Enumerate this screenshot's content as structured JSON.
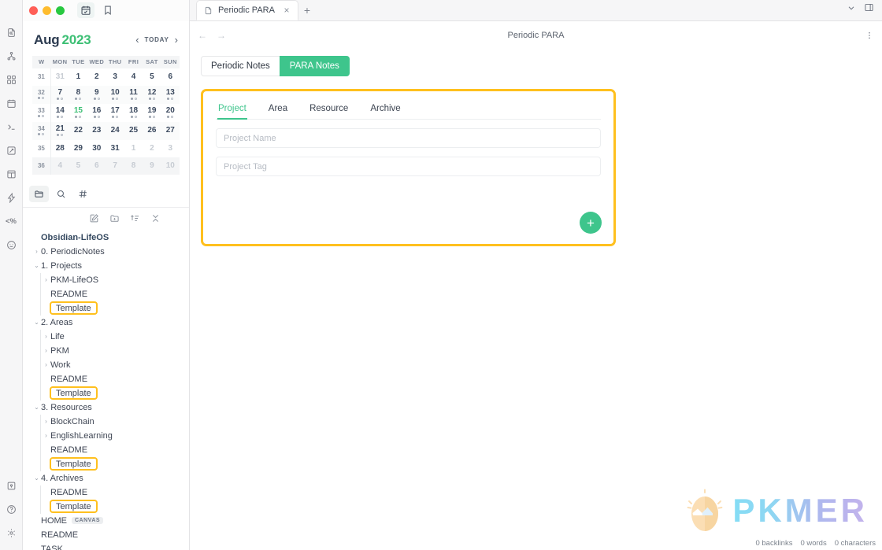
{
  "window": {
    "traffic_lights": [
      "close",
      "minimize",
      "maximize"
    ],
    "titlebar_icons": [
      "calendar-check-icon",
      "bookmark-icon",
      "right-sidebar-toggle-icon"
    ]
  },
  "rail": {
    "items": [
      {
        "name": "file-search-icon",
        "label": ""
      },
      {
        "name": "graph-view-icon",
        "label": ""
      },
      {
        "name": "dashboard-grid-icon",
        "label": ""
      },
      {
        "name": "calendar-icon",
        "label": ""
      },
      {
        "name": "terminal-icon",
        "label": ""
      },
      {
        "name": "excalidraw-icon",
        "label": ""
      },
      {
        "name": "layout-panels-icon",
        "label": ""
      },
      {
        "name": "lightning-icon",
        "label": ""
      },
      {
        "name": "templater-icon",
        "label": "<%"
      },
      {
        "name": "emoji-icon",
        "label": ""
      }
    ],
    "bottom_items": [
      {
        "name": "vault-switcher-icon"
      },
      {
        "name": "help-icon"
      },
      {
        "name": "settings-gear-icon"
      }
    ]
  },
  "calendar": {
    "month": "Aug",
    "year": "2023",
    "today_label": "TODAY",
    "prev_label": "‹",
    "next_label": "›",
    "columns": [
      "W",
      "MON",
      "TUE",
      "WED",
      "THU",
      "FRI",
      "SAT",
      "SUN"
    ],
    "weeks": [
      {
        "week": "31",
        "week_dots": false,
        "days": [
          {
            "n": "31",
            "mute": true,
            "dots": false
          },
          {
            "n": "1",
            "mute": false,
            "dots": false
          },
          {
            "n": "2",
            "mute": false,
            "dots": false
          },
          {
            "n": "3",
            "mute": false,
            "dots": false
          },
          {
            "n": "4",
            "mute": false,
            "dots": false
          },
          {
            "n": "5",
            "mute": false,
            "dots": false
          },
          {
            "n": "6",
            "mute": false,
            "dots": false
          }
        ]
      },
      {
        "week": "32",
        "week_dots": true,
        "days": [
          {
            "n": "7",
            "mute": false,
            "dots": true
          },
          {
            "n": "8",
            "mute": false,
            "dots": true
          },
          {
            "n": "9",
            "mute": false,
            "dots": true
          },
          {
            "n": "10",
            "mute": false,
            "dots": true
          },
          {
            "n": "11",
            "mute": false,
            "dots": true
          },
          {
            "n": "12",
            "mute": false,
            "dots": true
          },
          {
            "n": "13",
            "mute": false,
            "dots": true
          }
        ]
      },
      {
        "week": "33",
        "week_dots": true,
        "days": [
          {
            "n": "14",
            "mute": false,
            "dots": true
          },
          {
            "n": "15",
            "mute": false,
            "dots": true,
            "today": true
          },
          {
            "n": "16",
            "mute": false,
            "dots": true
          },
          {
            "n": "17",
            "mute": false,
            "dots": true
          },
          {
            "n": "18",
            "mute": false,
            "dots": true
          },
          {
            "n": "19",
            "mute": false,
            "dots": true
          },
          {
            "n": "20",
            "mute": false,
            "dots": true
          }
        ]
      },
      {
        "week": "34",
        "week_dots": true,
        "days": [
          {
            "n": "21",
            "mute": false,
            "dots": true
          },
          {
            "n": "22",
            "mute": false,
            "dots": false
          },
          {
            "n": "23",
            "mute": false,
            "dots": false
          },
          {
            "n": "24",
            "mute": false,
            "dots": false
          },
          {
            "n": "25",
            "mute": false,
            "dots": false
          },
          {
            "n": "26",
            "mute": false,
            "dots": false
          },
          {
            "n": "27",
            "mute": false,
            "dots": false
          }
        ]
      },
      {
        "week": "35",
        "week_dots": false,
        "days": [
          {
            "n": "28",
            "mute": false,
            "dots": false
          },
          {
            "n": "29",
            "mute": false,
            "dots": false
          },
          {
            "n": "30",
            "mute": false,
            "dots": false
          },
          {
            "n": "31",
            "mute": false,
            "dots": false
          },
          {
            "n": "1",
            "mute": true,
            "dots": false
          },
          {
            "n": "2",
            "mute": true,
            "dots": false
          },
          {
            "n": "3",
            "mute": true,
            "dots": false
          }
        ]
      },
      {
        "week": "36",
        "week_dots": false,
        "days": [
          {
            "n": "4",
            "mute": true,
            "dots": false
          },
          {
            "n": "5",
            "mute": true,
            "dots": false
          },
          {
            "n": "6",
            "mute": true,
            "dots": false
          },
          {
            "n": "7",
            "mute": true,
            "dots": false
          },
          {
            "n": "8",
            "mute": true,
            "dots": false
          },
          {
            "n": "9",
            "mute": true,
            "dots": false
          },
          {
            "n": "10",
            "mute": true,
            "dots": false
          }
        ]
      }
    ]
  },
  "explorer": {
    "tabs": [
      {
        "name": "files-tab",
        "icon": "folder-icon",
        "active": true
      },
      {
        "name": "search-tab",
        "icon": "search-icon",
        "active": false
      },
      {
        "name": "tags-tab",
        "icon": "hash-icon",
        "active": false
      }
    ],
    "tools": [
      {
        "name": "new-note-icon"
      },
      {
        "name": "new-folder-icon"
      },
      {
        "name": "sort-icon"
      },
      {
        "name": "collapse-all-icon"
      }
    ],
    "tree": [
      {
        "label": "Obsidian-LifeOS",
        "level": 0,
        "twisty": "",
        "kind": "vault"
      },
      {
        "label": "0. PeriodicNotes",
        "level": 1,
        "twisty": "›",
        "kind": "folder"
      },
      {
        "label": "1. Projects",
        "level": 1,
        "twisty": "⌄",
        "kind": "folder"
      },
      {
        "label": "PKM-LifeOS",
        "level": 2,
        "twisty": "›",
        "kind": "folder"
      },
      {
        "label": "README",
        "level": 2,
        "twisty": "",
        "kind": "file"
      },
      {
        "label": "Template",
        "level": 2,
        "twisty": "",
        "kind": "file",
        "highlight": true
      },
      {
        "label": "2. Areas",
        "level": 1,
        "twisty": "⌄",
        "kind": "folder"
      },
      {
        "label": "Life",
        "level": 2,
        "twisty": "›",
        "kind": "folder"
      },
      {
        "label": "PKM",
        "level": 2,
        "twisty": "›",
        "kind": "folder"
      },
      {
        "label": "Work",
        "level": 2,
        "twisty": "›",
        "kind": "folder"
      },
      {
        "label": "README",
        "level": 2,
        "twisty": "",
        "kind": "file"
      },
      {
        "label": "Template",
        "level": 2,
        "twisty": "",
        "kind": "file",
        "highlight": true
      },
      {
        "label": "3. Resources",
        "level": 1,
        "twisty": "⌄",
        "kind": "folder"
      },
      {
        "label": "BlockChain",
        "level": 2,
        "twisty": "›",
        "kind": "folder"
      },
      {
        "label": "EnglishLearning",
        "level": 2,
        "twisty": "›",
        "kind": "folder"
      },
      {
        "label": "README",
        "level": 2,
        "twisty": "",
        "kind": "file"
      },
      {
        "label": "Template",
        "level": 2,
        "twisty": "",
        "kind": "file",
        "highlight": true
      },
      {
        "label": "4. Archives",
        "level": 1,
        "twisty": "⌄",
        "kind": "folder"
      },
      {
        "label": "README",
        "level": 2,
        "twisty": "",
        "kind": "file"
      },
      {
        "label": "Template",
        "level": 2,
        "twisty": "",
        "kind": "file",
        "highlight": true
      },
      {
        "label": "HOME",
        "level": 1,
        "twisty": "",
        "kind": "file",
        "badge": "CANVAS"
      },
      {
        "label": "README",
        "level": 1,
        "twisty": "",
        "kind": "file"
      },
      {
        "label": "TASK",
        "level": 1,
        "twisty": "",
        "kind": "file"
      }
    ]
  },
  "tabstrip": {
    "tab_title": "Periodic PARA",
    "close_label": "×",
    "new_tab_label": "+",
    "dropdown_icon": "chevron-down-icon",
    "right_sidebar_icon": "right-sidebar-toggle-icon"
  },
  "view": {
    "title": "Periodic PARA",
    "back_label": "←",
    "forward_label": "→",
    "kebab_label": "⋮",
    "segments": [
      {
        "label": "Periodic Notes",
        "selected": false
      },
      {
        "label": "PARA Notes",
        "selected": true
      }
    ]
  },
  "para_card": {
    "tabs": [
      {
        "label": "Project",
        "active": true
      },
      {
        "label": "Area",
        "active": false
      },
      {
        "label": "Resource",
        "active": false
      },
      {
        "label": "Archive",
        "active": false
      }
    ],
    "fields": [
      {
        "name": "project-name-input",
        "placeholder": "Project Name",
        "value": ""
      },
      {
        "name": "project-tag-input",
        "placeholder": "Project Tag",
        "value": ""
      }
    ],
    "add_label": "+"
  },
  "watermark": {
    "text": "PKMER"
  },
  "statusbar": {
    "backlinks": "0 backlinks",
    "words": "0 words",
    "characters": "0 characters"
  },
  "colors": {
    "accent_green": "#3ec58c",
    "highlight_yellow": "#ffc01e",
    "year_green": "#3cbf74",
    "month_navy": "#2b3a4f"
  }
}
